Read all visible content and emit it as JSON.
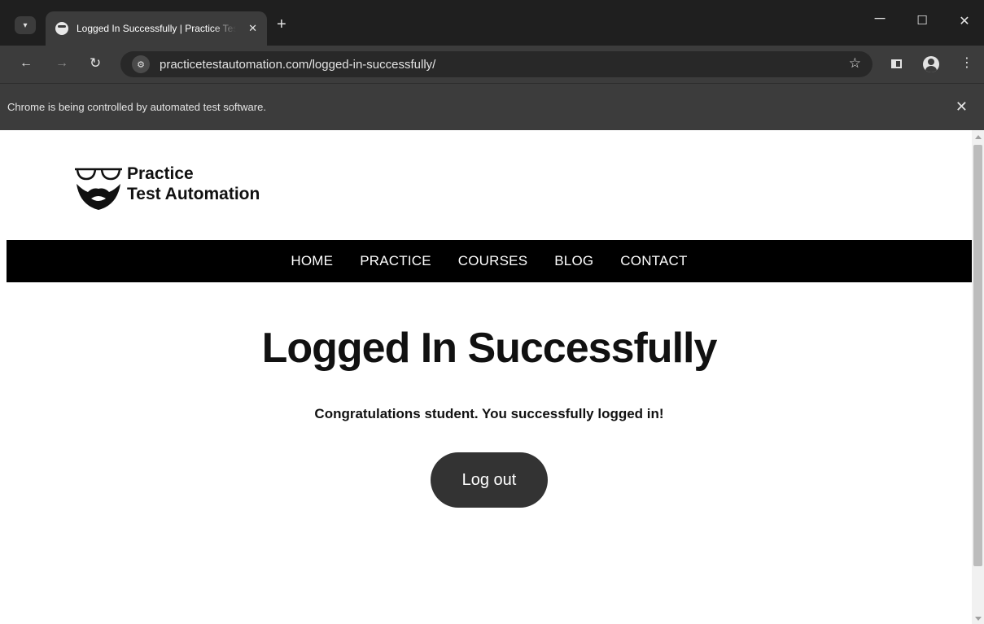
{
  "browser": {
    "tab": {
      "title": "Logged In Successfully | Practice Test Automation",
      "close": "✕"
    },
    "new_tab": "+",
    "window": {
      "minimize": "─",
      "maximize": "☐",
      "close": "✕"
    },
    "toolbar": {
      "back": "←",
      "forward": "→",
      "reload": "↻",
      "site_info": "⚙",
      "url": "practicetestautomation.com/logged-in-successfully/",
      "bookmark": "☆",
      "menu": "⋮"
    },
    "infobar": {
      "message": "Chrome is being controlled by automated test software.",
      "close": "✕"
    }
  },
  "site": {
    "logo": {
      "line1": "Practice",
      "line2": "Test Automation"
    },
    "nav": [
      {
        "label": "HOME"
      },
      {
        "label": "PRACTICE"
      },
      {
        "label": "COURSES"
      },
      {
        "label": "BLOG"
      },
      {
        "label": "CONTACT"
      }
    ],
    "heading": "Logged In Successfully",
    "message": "Congratulations student. You successfully logged in!",
    "logout_label": "Log out"
  }
}
